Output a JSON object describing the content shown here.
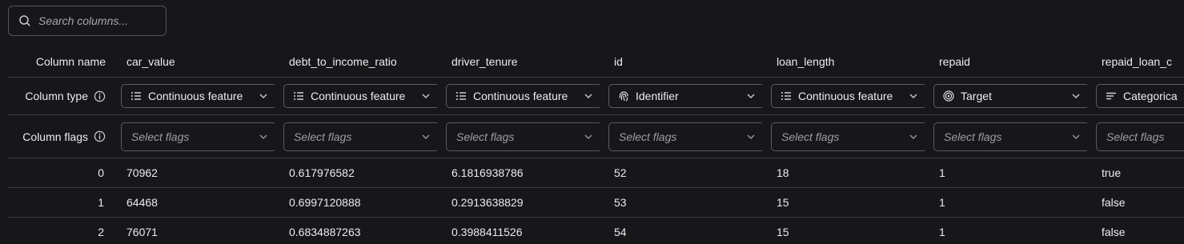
{
  "search": {
    "placeholder": "Search columns..."
  },
  "labels": {
    "column_name": "Column name",
    "column_type": "Column type",
    "column_flags": "Column flags"
  },
  "columns": [
    {
      "name": "car_value",
      "type": "Continuous feature",
      "type_icon": "list-icon",
      "flags_placeholder": "Select flags"
    },
    {
      "name": "debt_to_income_ratio",
      "type": "Continuous feature",
      "type_icon": "list-icon",
      "flags_placeholder": "Select flags"
    },
    {
      "name": "driver_tenure",
      "type": "Continuous feature",
      "type_icon": "list-icon",
      "flags_placeholder": "Select flags"
    },
    {
      "name": "id",
      "type": "Identifier",
      "type_icon": "fingerprint-icon",
      "flags_placeholder": "Select flags"
    },
    {
      "name": "loan_length",
      "type": "Continuous feature",
      "type_icon": "list-icon",
      "flags_placeholder": "Select flags"
    },
    {
      "name": "repaid",
      "type": "Target",
      "type_icon": "target-icon",
      "flags_placeholder": "Select flags"
    },
    {
      "name": "repaid_loan_c",
      "type": "Categorica",
      "type_icon": "lines-icon",
      "flags_placeholder": "Select flags"
    }
  ],
  "rows": [
    {
      "index": "0",
      "values": [
        "70962",
        "0.617976582",
        "6.1816938786",
        "52",
        "18",
        "1",
        "true"
      ]
    },
    {
      "index": "1",
      "values": [
        "64468",
        "0.6997120888",
        "0.2913638829",
        "53",
        "15",
        "1",
        "false"
      ]
    },
    {
      "index": "2",
      "values": [
        "76071",
        "0.6834887263",
        "0.3988411526",
        "54",
        "15",
        "1",
        "false"
      ]
    }
  ]
}
